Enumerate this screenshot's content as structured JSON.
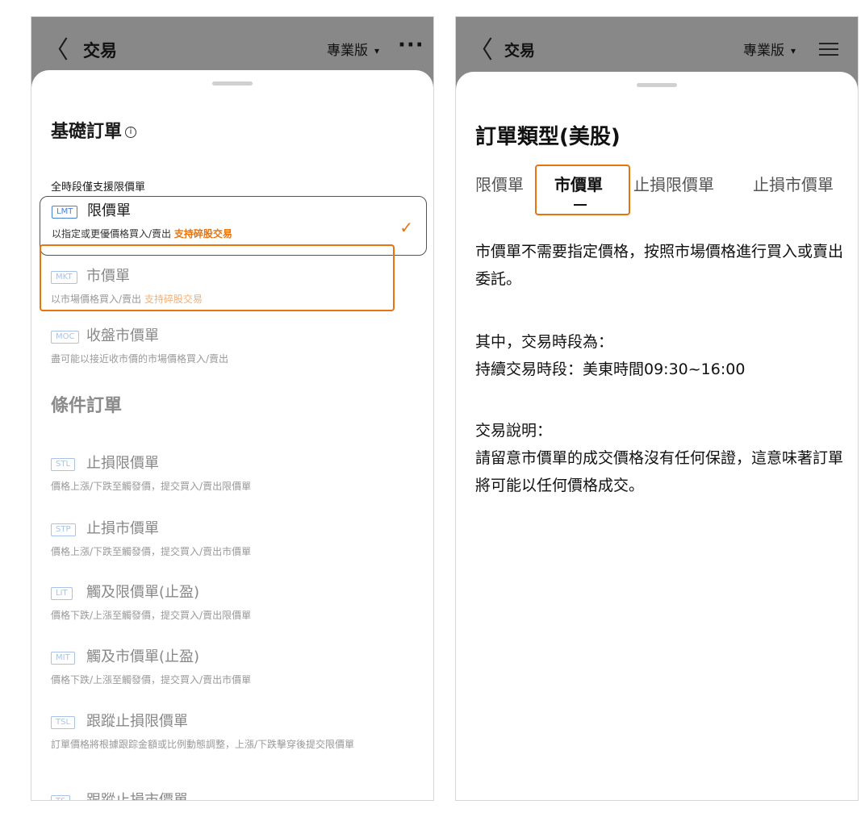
{
  "left": {
    "header": {
      "back_glyph": "〈",
      "title": "交易",
      "pro_label": "專業版",
      "caret": "▾",
      "more": "···"
    },
    "basic": {
      "title": "基礎訂單",
      "info_glyph": "i",
      "subhead": "全時段僅支援限價單"
    },
    "basic_orders": [
      {
        "tag": "LMT",
        "name": "限價單",
        "desc": "以指定或更優價格買入/賣出",
        "frac": "支持碎股交易",
        "selected": true
      },
      {
        "tag": "MKT",
        "name": "市價單",
        "desc": "以市場價格買入/賣出",
        "frac": "支持碎股交易"
      },
      {
        "tag": "MOC",
        "name": "收盤市價單",
        "desc": "盡可能以接近收市價的市場價格買入/賣出"
      }
    ],
    "conditional": {
      "title": "條件訂單"
    },
    "conditional_orders": [
      {
        "tag": "STL",
        "name": "止損限價單",
        "desc": "價格上漲/下跌至觸發價，提交買入/賣出限價單"
      },
      {
        "tag": "STP",
        "name": "止損市價單",
        "desc": "價格上漲/下跌至觸發價，提交買入/賣出市價單"
      },
      {
        "tag": "LIT",
        "name": "觸及限價單(止盈)",
        "desc": "價格下跌/上漲至觸發價，提交買入/賣出限價單"
      },
      {
        "tag": "MIT",
        "name": "觸及市價單(止盈)",
        "desc": "價格下跌/上漲至觸發價，提交買入/賣出市價單"
      },
      {
        "tag": "TSL",
        "name": "跟蹤止損限價單",
        "desc": "訂單價格將根據跟踪金額或比例動態調整，上漲/下跌擊穿後提交限價單"
      },
      {
        "tag": "TS",
        "name": "跟蹤止損市價單",
        "desc": ""
      }
    ],
    "check_glyph": "✓"
  },
  "right": {
    "header": {
      "back_glyph": "〈",
      "title": "交易",
      "pro_label": "專業版",
      "caret": "▾"
    },
    "title": "訂單類型(美股)",
    "tabs": [
      "限價單",
      "市價單",
      "止損限價單",
      "止損市價單"
    ],
    "active_tab": "市價單",
    "paragraphs": [
      "市價單不需要指定價格，按照市場價格進行買入或賣出委託。",
      "其中，交易時段為：",
      "持續交易時段：美東時間09:30~16:00",
      "交易說明：",
      "請留意市價單的成交價格沒有任何保證，這意味著訂單將可能以任何價格成交。"
    ]
  },
  "colors": {
    "accent_orange": "#e8730f",
    "tag_blue": "#4a7fd4",
    "header_gray": "#888888"
  }
}
